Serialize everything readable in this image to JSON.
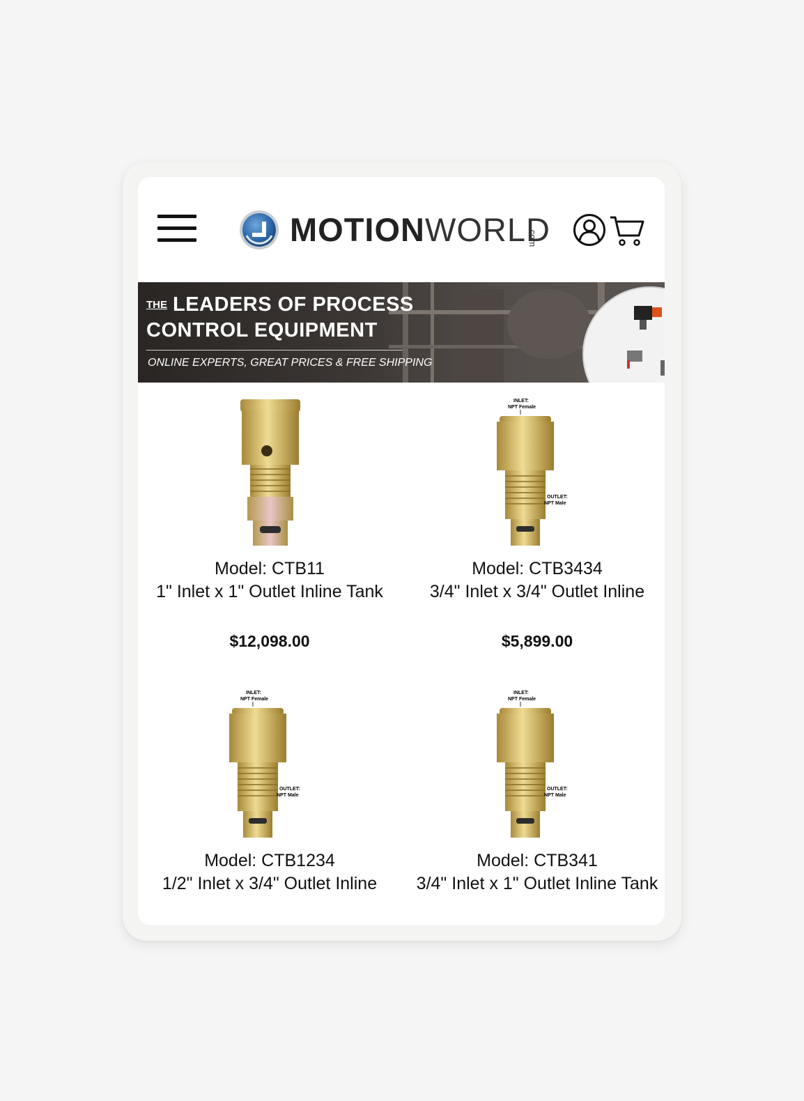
{
  "header": {
    "menu_icon": "hamburger-menu-icon",
    "logo": {
      "bold": "MOTION",
      "light": "WORLD",
      "suffix": ".com"
    },
    "account_icon": "user-account-icon",
    "cart_icon": "shopping-cart-icon"
  },
  "banner": {
    "the": "THE",
    "line1": "LEADERS OF PROCESS",
    "line2": "CONTROL EQUIPMENT",
    "subtitle": "ONLINE EXPERTS, GREAT PRICES & FREE SHIPPING"
  },
  "products": [
    {
      "model": "Model: CTB11",
      "description": "1\" Inlet x 1\" Outlet Inline Tank",
      "price": "$12,098.00",
      "image": "brass-check-valve"
    },
    {
      "model": "Model: CTB3434",
      "description": "3/4\" Inlet x 3/4\" Outlet Inline",
      "price": "$5,899.00",
      "image": "brass-check-valve-labeled",
      "label_inlet": "INLET:",
      "label_inlet_type": "NPT Female",
      "label_outlet": "OUTLET:",
      "label_outlet_type": "NPT Male"
    },
    {
      "model": "Model: CTB1234",
      "description": "1/2\" Inlet x 3/4\" Outlet Inline",
      "image": "brass-check-valve-labeled",
      "label_inlet": "INLET:",
      "label_inlet_type": "NPT Female",
      "label_outlet": "OUTLET:",
      "label_outlet_type": "NPT Male"
    },
    {
      "model": "Model: CTB341",
      "description": "3/4\" Inlet x 1\" Outlet Inline Tank",
      "image": "brass-check-valve-labeled",
      "label_inlet": "INLET:",
      "label_inlet_type": "NPT Female",
      "label_outlet": "OUTLET:",
      "label_outlet_type": "NPT Male"
    }
  ],
  "colors": {
    "page_bg": "#f5f5f5",
    "brass": "#c9a94a",
    "logo_blue": "#2f6fb0"
  }
}
